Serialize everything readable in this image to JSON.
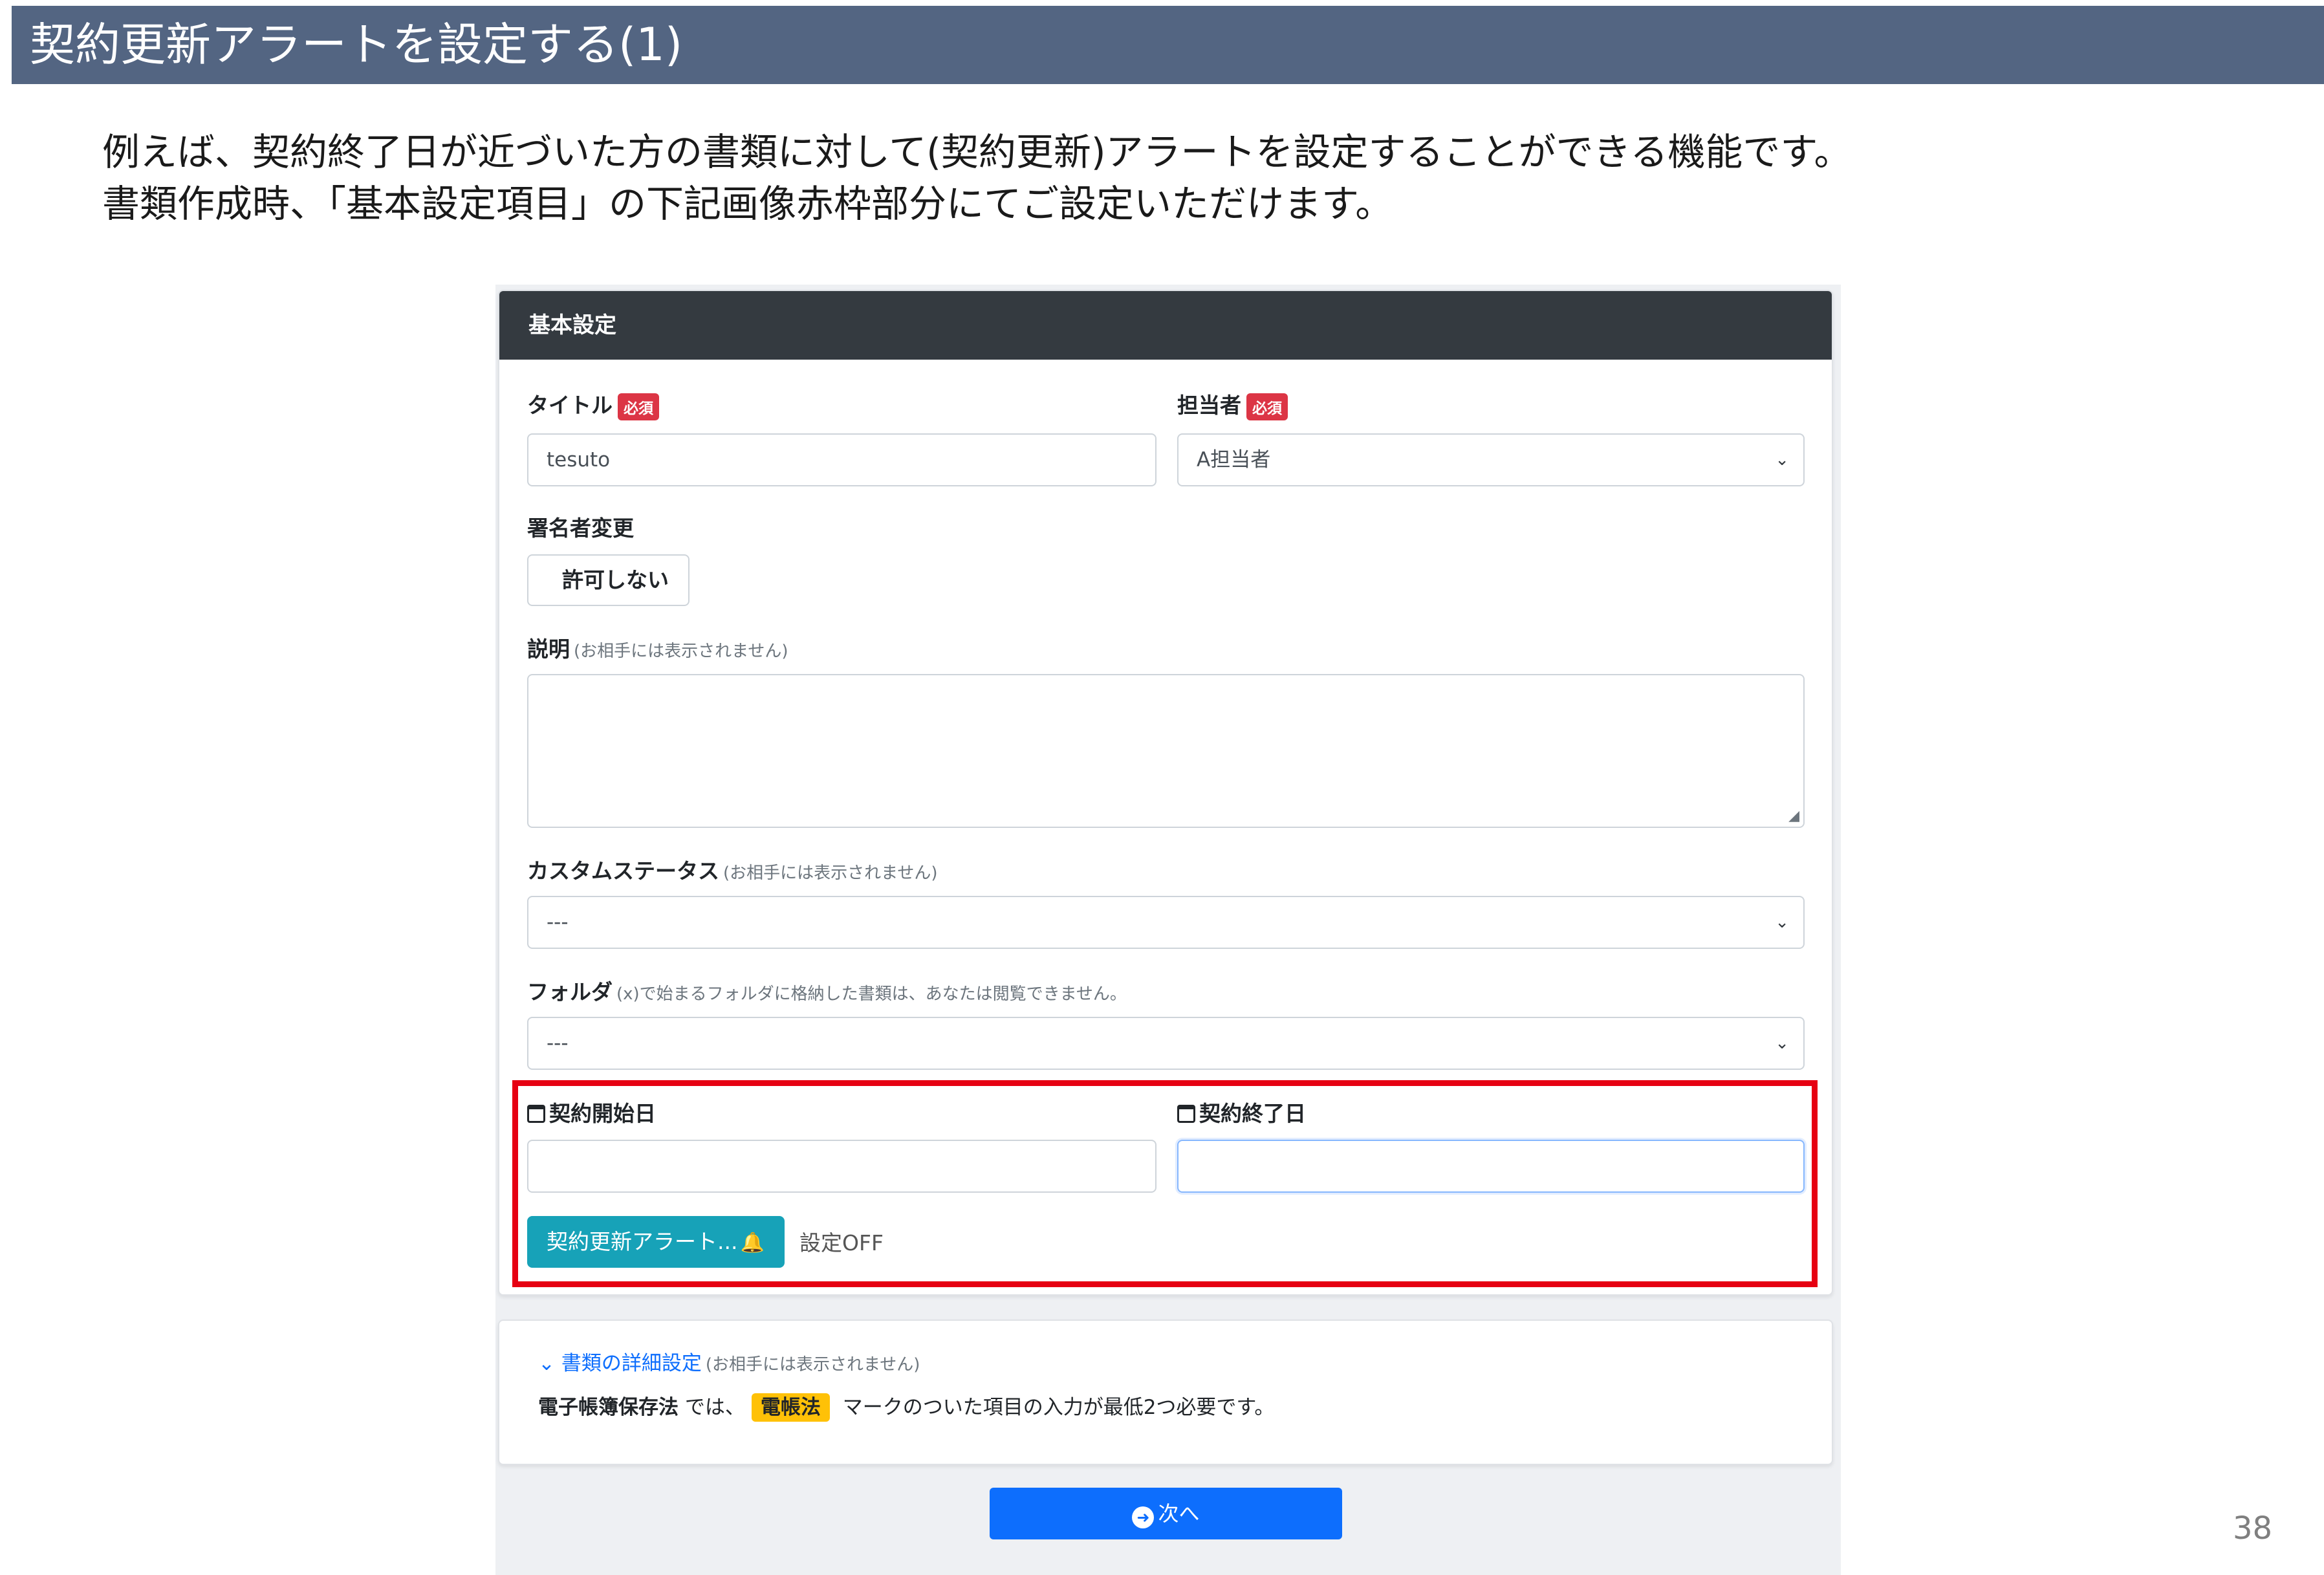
{
  "slide": {
    "title": "契約更新アラートを設定する(1)",
    "lead_line1": "例えば、契約終了日が近づいた方の書類に対して(契約更新)アラートを設定することができる機能です。",
    "lead_line2": "書類作成時、「基本設定項目」の下記画像赤枠部分にてご設定いただけます。",
    "page_number": "38"
  },
  "form": {
    "card_title": "基本設定",
    "required_badge": "必須",
    "title_label": "タイトル",
    "title_value": "tesuto",
    "assignee_label": "担当者",
    "assignee_value": "A担当者",
    "signer_change_label": "署名者変更",
    "signer_change_value": "許可しない",
    "description_label": "説明",
    "hidden_from_partner": "(お相手には表示されません)",
    "custom_status_label": "カスタムステータス",
    "custom_status_value": "---",
    "folder_label": "フォルダ",
    "folder_hint": "(x)で始まるフォルダに格納した書類は、あなたは閲覧できません。",
    "folder_value": "---",
    "contract_start_label": "契約開始日",
    "contract_end_label": "契約終了日",
    "alert_button": "契約更新アラート...",
    "alert_status": "設定OFF"
  },
  "detail": {
    "toggle_label": "書類の詳細設定",
    "toggle_hint": "(お相手には表示されません)",
    "note_law": "電子帳簿保存法",
    "note_mid": " では、",
    "note_badge": "電帳法",
    "note_tail": " マークのついた項目の入力が最低2つ必要です。"
  },
  "footer": {
    "next_button": "次へ"
  },
  "colors": {
    "header_bar": "#536582",
    "card_header": "#343a40",
    "required_badge": "#dc3545",
    "alert_button": "#17a2b8",
    "highlight_frame": "#e60012",
    "primary": "#0d6efd",
    "mark_badge": "#ffc107"
  }
}
